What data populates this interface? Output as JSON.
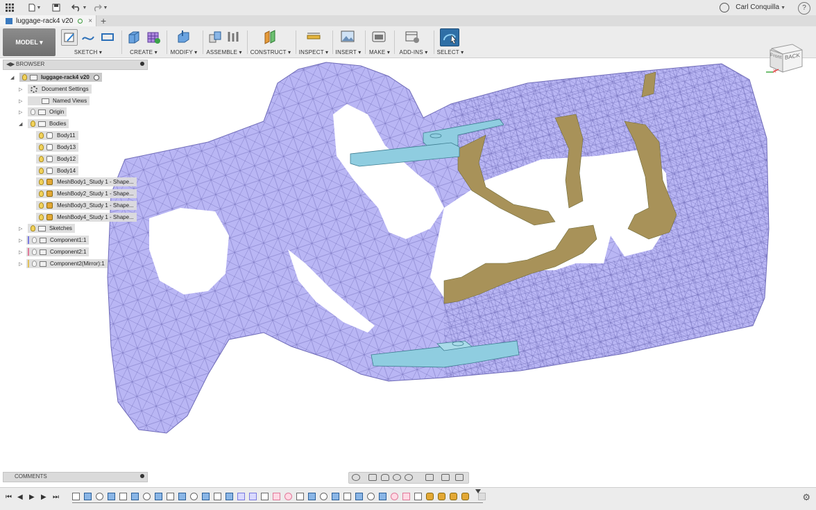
{
  "app": {
    "user_name": "Carl Conquilla",
    "help_label": "?"
  },
  "tabs": [
    {
      "label": "luggage-rack4 v20",
      "close": "×"
    }
  ],
  "tab_add": "+",
  "toolbar": {
    "workspace": "MODEL ▾",
    "groups": [
      {
        "label": "SKETCH ▾"
      },
      {
        "label": "CREATE ▾"
      },
      {
        "label": "MODIFY ▾"
      },
      {
        "label": "ASSEMBLE ▾"
      },
      {
        "label": "CONSTRUCT ▾"
      },
      {
        "label": "INSPECT ▾"
      },
      {
        "label": "INSERT ▾"
      },
      {
        "label": "MAKE ▾"
      },
      {
        "label": "ADD-INS ▾"
      },
      {
        "label": "SELECT ▾"
      }
    ]
  },
  "viewcube": {
    "front": "Front",
    "back": "BACK",
    "axis_x": "X"
  },
  "browser": {
    "title": "BROWSER",
    "root": "luggage-rack4 v20",
    "items": [
      {
        "label": "Document Settings"
      },
      {
        "label": "Named Views"
      },
      {
        "label": "Origin"
      },
      {
        "label": "Bodies"
      },
      {
        "label": "Body11"
      },
      {
        "label": "Body13"
      },
      {
        "label": "Body12"
      },
      {
        "label": "Body14"
      },
      {
        "label": "MeshBody1_Study 1 - Shape..."
      },
      {
        "label": "MeshBody2_Study 1 - Shape..."
      },
      {
        "label": "MeshBody3_Study 1 - Shape..."
      },
      {
        "label": "MeshBody4_Study 1 - Shape..."
      },
      {
        "label": "Sketches"
      },
      {
        "label": "Component1:1"
      },
      {
        "label": "Component2:1"
      },
      {
        "label": "Component2(Mirror):1"
      }
    ]
  },
  "comments": {
    "title": "COMMENTS"
  },
  "colors": {
    "mesh": "#b9b6f4",
    "mesh_edge": "#6f6bb8",
    "cut_face": "#a89259",
    "bracket": "#8fcde0",
    "select_highlight": "#2f6fa6"
  }
}
